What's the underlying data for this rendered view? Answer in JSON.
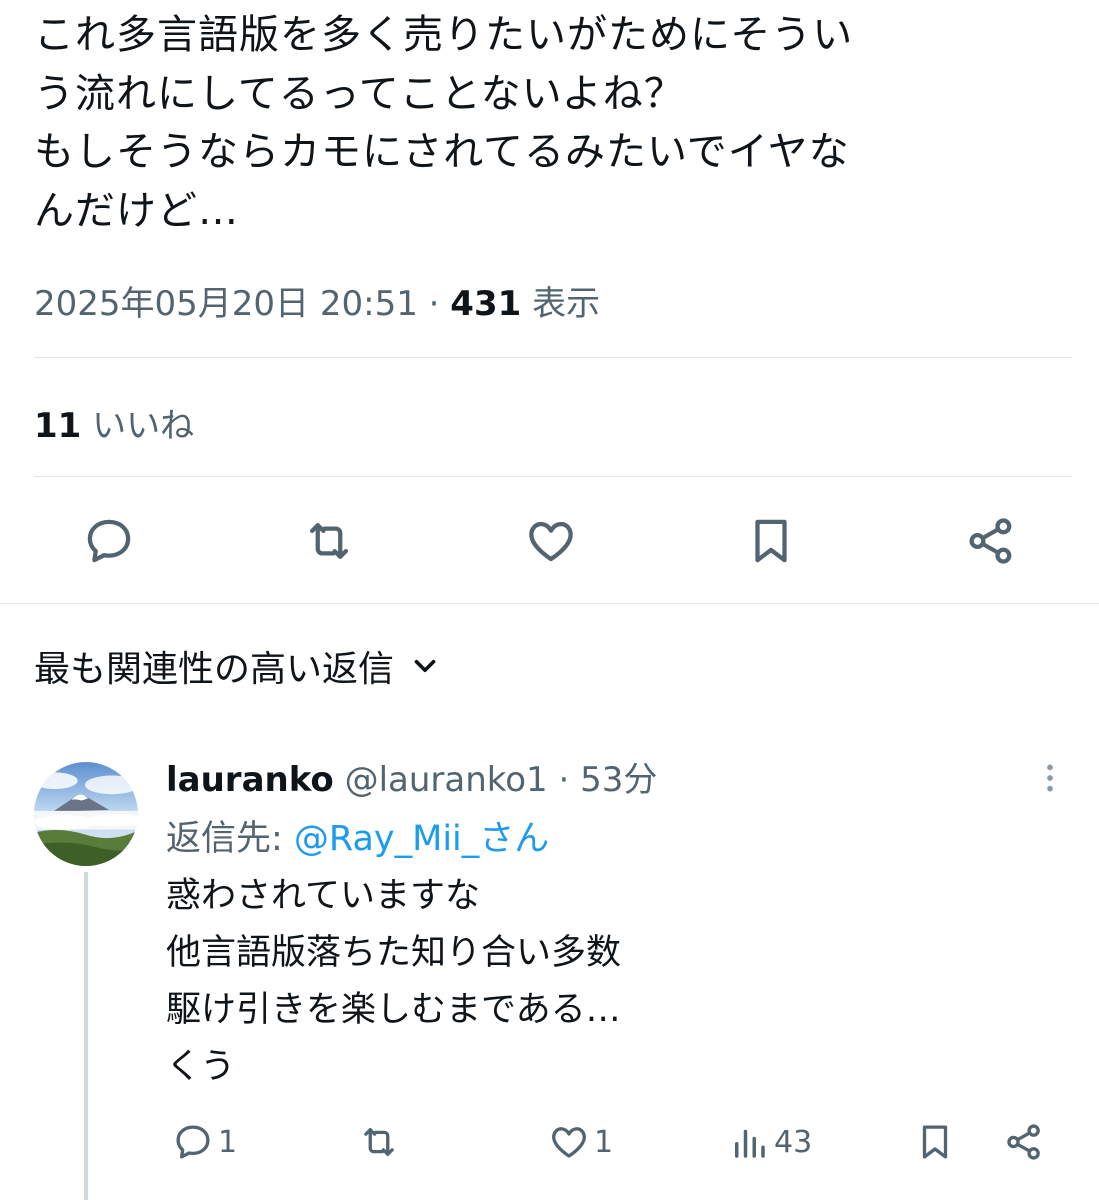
{
  "tweet": {
    "text": "これ多言語版を多く売りたいがためにそうい\nう流れにしてるってことないよね？\nもしそうならカモにされてるみたいでイヤな\nんだけど…",
    "timestamp": "2025年05月20日 20:51",
    "separator": " · ",
    "views_count": "431",
    "views_label": " 表示",
    "likes_count": "11",
    "likes_label": " いいね"
  },
  "actions": {
    "reply_icon": "reply-icon",
    "retweet_icon": "retweet-icon",
    "like_icon": "heart-icon",
    "bookmark_icon": "bookmark-icon",
    "share_icon": "share-icon"
  },
  "replies_sort": {
    "label": "最も関連性の高い返信"
  },
  "reply": {
    "display_name": "lauranko",
    "handle": " @lauranko1",
    "time": " · 53分",
    "reply_to_label": "返信先: ",
    "reply_to_handle": "@Ray_Mii_さん",
    "text": "惑わされていますな\n他言語版落ちた知り合い多数\n駆け引きを楽しむまである…\nくう",
    "reply_count": "1",
    "like_count": "1",
    "view_count": "43"
  },
  "colors": {
    "text_primary": "#0f1419",
    "text_secondary": "#536471",
    "link": "#1d9bf0",
    "divider": "#e1e6ea"
  }
}
